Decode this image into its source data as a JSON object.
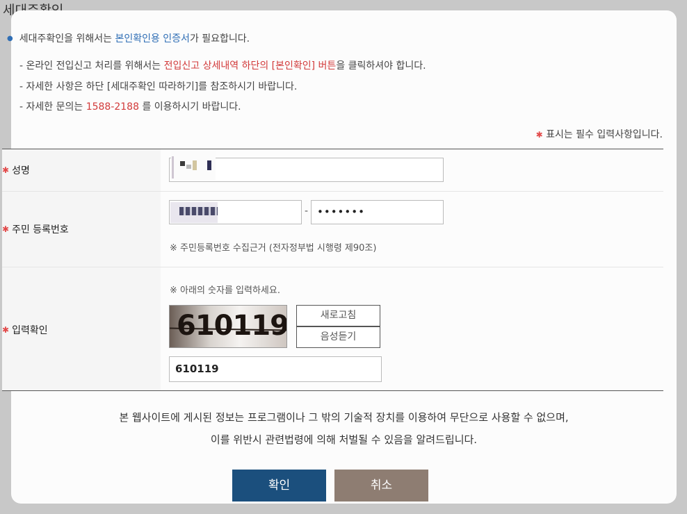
{
  "page": {
    "title": "세대주확인"
  },
  "intro": {
    "part1": "세대주확인을 위해서는 ",
    "highlight": "본인확인용 인증서",
    "part2": "가 필요합니다."
  },
  "notes": {
    "line1": {
      "prefix": "- 온라인 전입신고 처리를 위해서는 ",
      "red": "전입신고 상세내역 하단의 [본인확인] 버튼",
      "suffix": "을 클릭하셔야 합니다."
    },
    "line2": "- 자세한 사항은 하단 [세대주확인 따라하기]를 참조하시기 바랍니다.",
    "line3": {
      "prefix": "- 자세한 문의는 ",
      "phone": "1588-2188",
      "suffix": " 를 이용하시기 바랍니다."
    }
  },
  "required_note": {
    "star": "✱",
    "text": " 표시는 필수 입력사항입니다."
  },
  "form": {
    "name": {
      "label": "성명",
      "value": ""
    },
    "rrn": {
      "label": "주민 등록번호",
      "first": "",
      "separator": "-",
      "second": "•••••••",
      "help": "※  주민등록번호 수집근거 (전자정부법 시행령 제90조)"
    },
    "captcha": {
      "label": "입력확인",
      "help": "※  아래의 숫자를 입력하세요.",
      "image_text": "610119",
      "refresh_label": "새로고침",
      "audio_label": "음성듣기",
      "value": "610119"
    }
  },
  "disclaimer": {
    "line1": "본 웹사이트에 게시된 정보는 프로그램이나 그 밖의 기술적 장치를 이용하여 무단으로 사용할 수 없으며,",
    "line2": "이를 위반시 관련법령에 의해 처벌될 수 있음을 알려드립니다."
  },
  "buttons": {
    "confirm": "확인",
    "cancel": "취소"
  },
  "colors": {
    "confirm": "#1b4f7d",
    "cancel": "#8e7d72",
    "accent_blue": "#2f6eb5",
    "accent_red": "#d23a3a"
  }
}
